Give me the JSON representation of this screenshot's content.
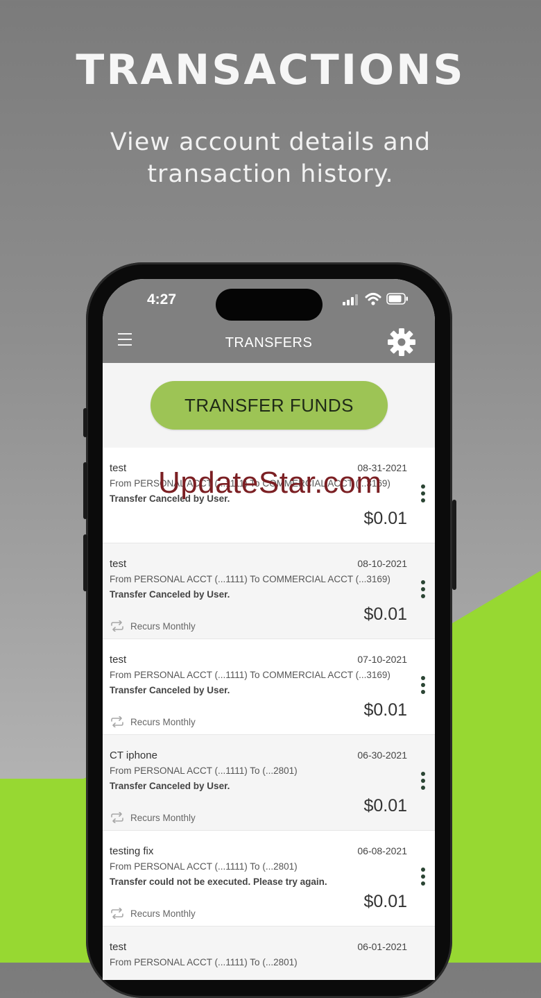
{
  "promo": {
    "headline": "TRANSACTIONS",
    "subline": [
      "View account details and",
      "transaction history."
    ]
  },
  "status_bar": {
    "time": "4:27"
  },
  "nav": {
    "title": "TRANSFERS"
  },
  "actions": {
    "transfer_label": "TRANSFER FUNDS"
  },
  "transfers": [
    {
      "name": "test",
      "date": "08-31-2021",
      "route": "From PERSONAL ACCT (...1111) To COMMERCIAL ACCT (...3169)",
      "status": "Transfer Canceled by User.",
      "amount": "$0.01",
      "recurrence": ""
    },
    {
      "name": "test",
      "date": "08-10-2021",
      "route": "From PERSONAL ACCT (...1111) To COMMERCIAL ACCT (...3169)",
      "status": "Transfer Canceled by User.",
      "amount": "$0.01",
      "recurrence": "Recurs Monthly"
    },
    {
      "name": "test",
      "date": "07-10-2021",
      "route": "From PERSONAL ACCT (...1111) To COMMERCIAL ACCT (...3169)",
      "status": "Transfer Canceled by User.",
      "amount": "$0.01",
      "recurrence": "Recurs Monthly"
    },
    {
      "name": "CT iphone",
      "date": "06-30-2021",
      "route": "From PERSONAL ACCT (...1111) To (...2801)",
      "status": "Transfer Canceled by User.",
      "amount": "$0.01",
      "recurrence": "Recurs Monthly"
    },
    {
      "name": "testing fix",
      "date": "06-08-2021",
      "route": "From PERSONAL ACCT (...1111) To (...2801)",
      "status": "Transfer could not be executed. Please try again.",
      "amount": "$0.01",
      "recurrence": "Recurs Monthly"
    },
    {
      "name": "test",
      "date": "06-01-2021",
      "route": "From PERSONAL ACCT (...1111) To (...2801)",
      "status": "",
      "amount": "",
      "recurrence": ""
    }
  ],
  "watermark": "UpdateStar.com",
  "icons": {
    "menu": "hamburger-icon",
    "settings": "gear-icon",
    "row_menu": "kebab-icon",
    "recurrence": "repeat-icon"
  },
  "colors": {
    "accent_green": "#9dc455",
    "background_green": "#97d832",
    "nav_gray": "#808080",
    "kebab": "#2b4534"
  }
}
